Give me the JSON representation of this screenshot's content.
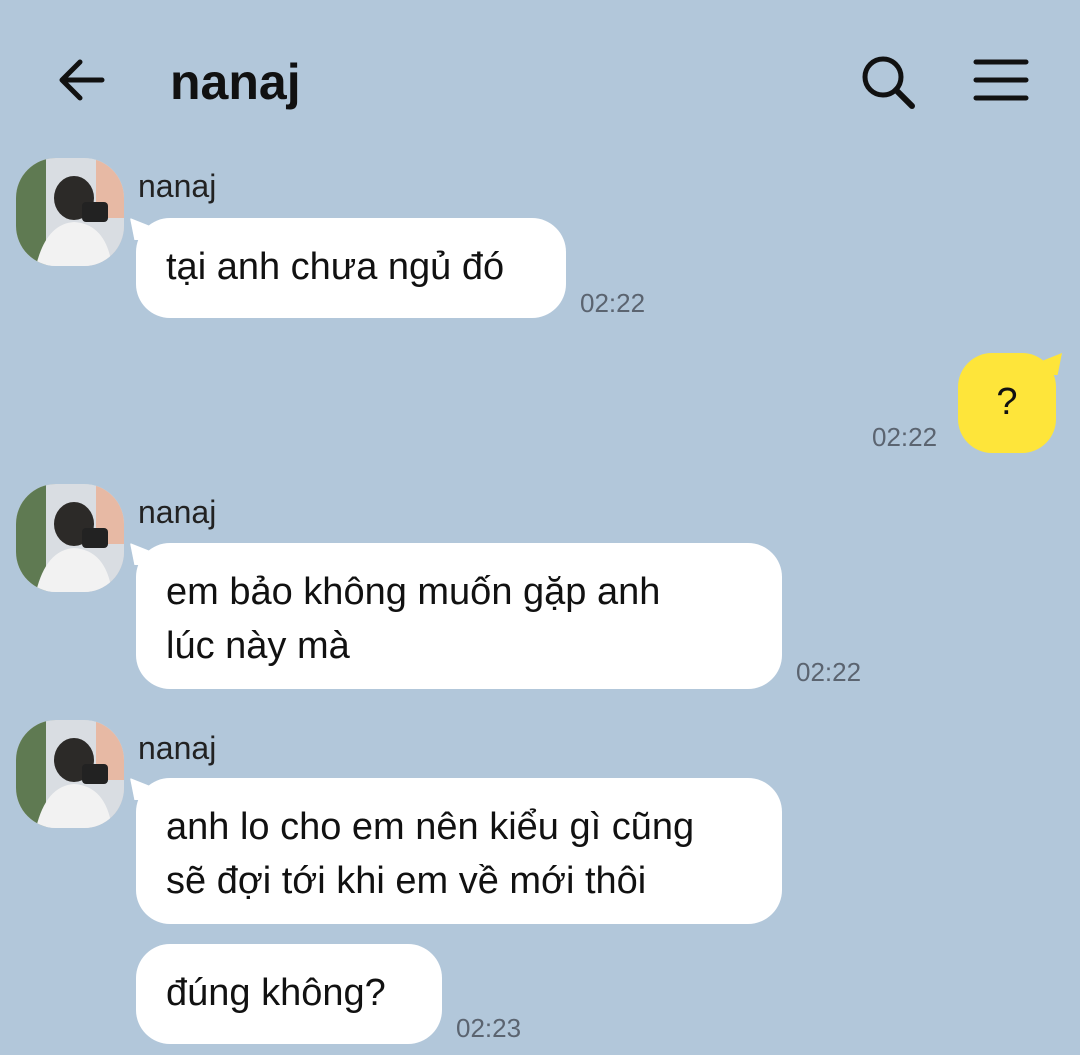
{
  "header": {
    "title": "nanaj",
    "back_icon": "arrow-left-icon",
    "search_icon": "search-icon",
    "menu_icon": "hamburger-menu-icon"
  },
  "colors": {
    "background": "#b2c7da",
    "incoming_bubble": "#ffffff",
    "outgoing_bubble": "#fee53a"
  },
  "messages": [
    {
      "sender": "nanaj",
      "text": "tại anh chưa ngủ đó",
      "time": "02:22"
    },
    {
      "sender": "me",
      "text": "?",
      "time": "02:22"
    },
    {
      "sender": "nanaj",
      "line1": "em bảo không muốn gặp anh",
      "line2": "lúc này mà",
      "time": "02:22"
    },
    {
      "sender": "nanaj",
      "line1": "anh lo cho em nên kiểu gì cũng",
      "line2": "sẽ đợi tới khi em về mới thôi",
      "time": ""
    },
    {
      "sender": "nanaj",
      "text": "đúng không?",
      "time": "02:23"
    }
  ]
}
